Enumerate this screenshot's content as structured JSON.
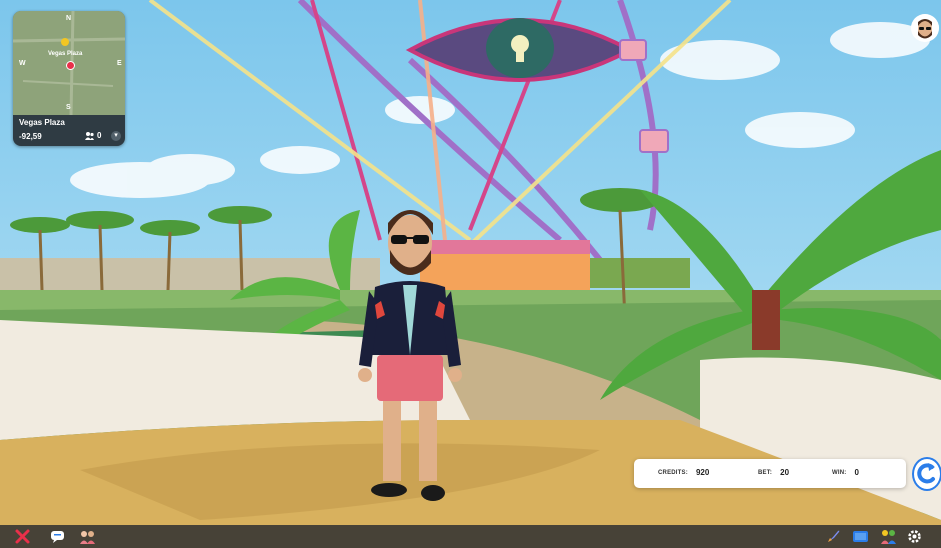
{
  "minimap": {
    "compass": {
      "n": "N",
      "s": "S",
      "e": "E",
      "w": "W"
    },
    "poi_label": "Vegas Plaza",
    "place_name": "Vegas Plaza",
    "coordinates": "-92,59",
    "users_online": "0",
    "expand_symbol": "▾"
  },
  "slot_machine": {
    "credits_label": "CREDITS:",
    "credits_value": "920",
    "bet_label": "BET:",
    "bet_value": "20",
    "win_label": "WIN:",
    "win_value": "0"
  },
  "icons": {
    "left": [
      "close-icon",
      "chat-icon",
      "friends-icon"
    ],
    "right": [
      "rocket-icon",
      "map-icon",
      "people-icon",
      "settings-icon"
    ]
  },
  "colors": {
    "sky": "#8fd0ef",
    "close_red": "#e8304a",
    "spin_blue": "#2b7de9",
    "minimap_bg": "#2f3b43"
  }
}
